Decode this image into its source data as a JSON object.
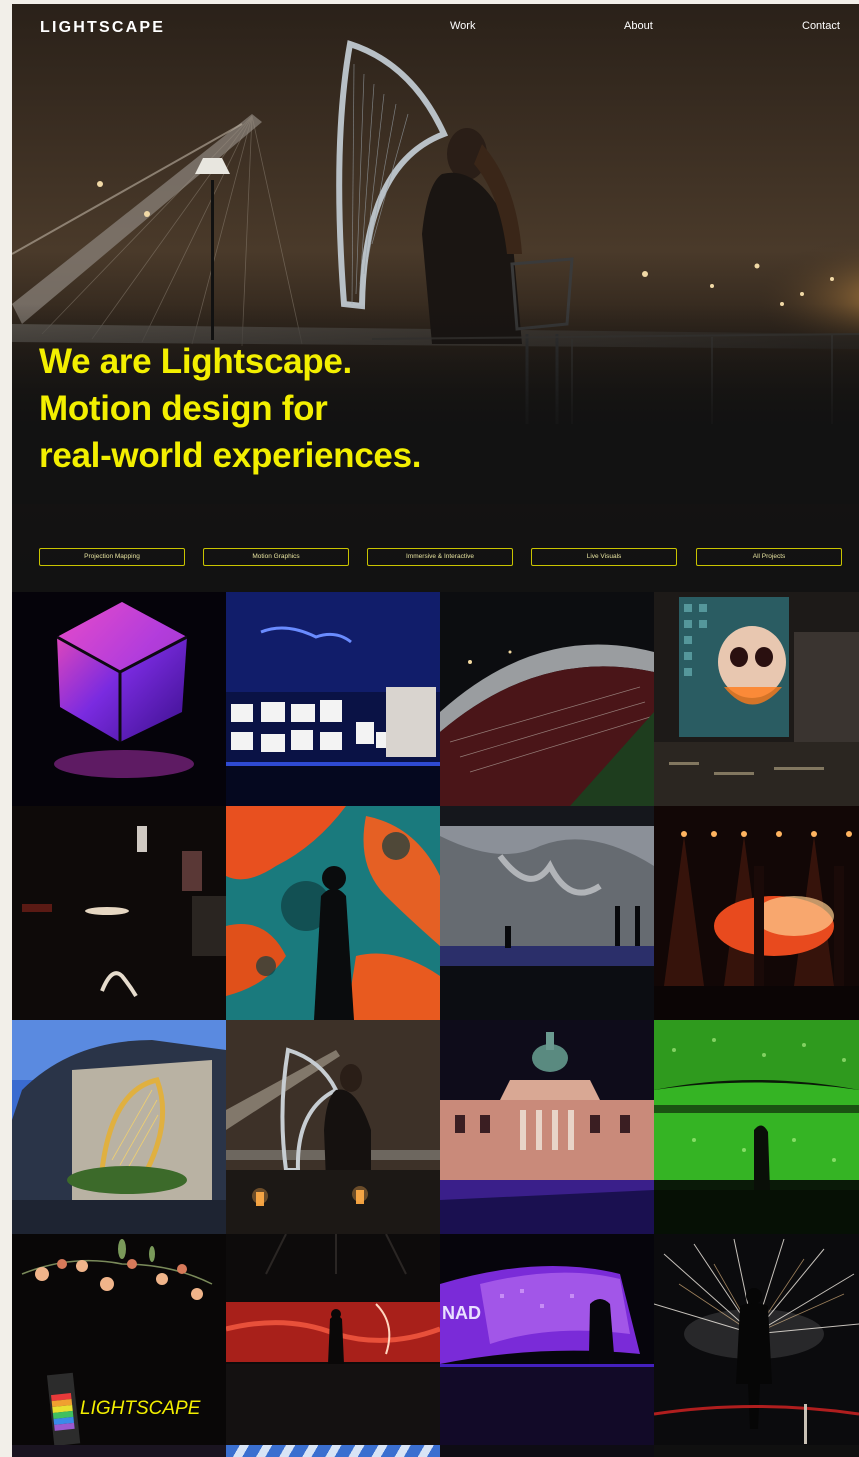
{
  "brand": {
    "logo_text": "LIGHTSCAPE"
  },
  "nav": {
    "work": "Work",
    "about": "About",
    "contact": "Contact"
  },
  "hero": {
    "headline_line1": "We are Lightscape.",
    "headline_line2": "Motion design for",
    "headline_line3": "real-world experiences.",
    "accent_color": "#f3ef00"
  },
  "filters": [
    {
      "label": "Projection Mapping"
    },
    {
      "label": "Motion Graphics"
    },
    {
      "label": "Immersive & Interactive"
    },
    {
      "label": "Live Visuals"
    },
    {
      "label": "All Projects"
    }
  ],
  "projects": [
    {
      "name": "glowing-cube-project"
    },
    {
      "name": "electric-picnic-stage-project"
    },
    {
      "name": "stadium-project"
    },
    {
      "name": "skull-building-projection-project"
    },
    {
      "name": "dark-gallery-installation-project"
    },
    {
      "name": "immersive-teal-orange-room-project"
    },
    {
      "name": "monochrome-stage-project"
    },
    {
      "name": "red-concert-stage-project"
    },
    {
      "name": "harp-building-projection-project"
    },
    {
      "name": "harpist-bridge-project"
    },
    {
      "name": "custom-house-projection-project"
    },
    {
      "name": "green-laser-crowd-project"
    },
    {
      "name": "flowers-lightscape-sign-project",
      "sign_text": "LIGHTSCAPE"
    },
    {
      "name": "red-wave-screen-project"
    },
    {
      "name": "purple-wall-projection-project",
      "sign_text": "NAD"
    },
    {
      "name": "firework-sparks-project"
    }
  ]
}
